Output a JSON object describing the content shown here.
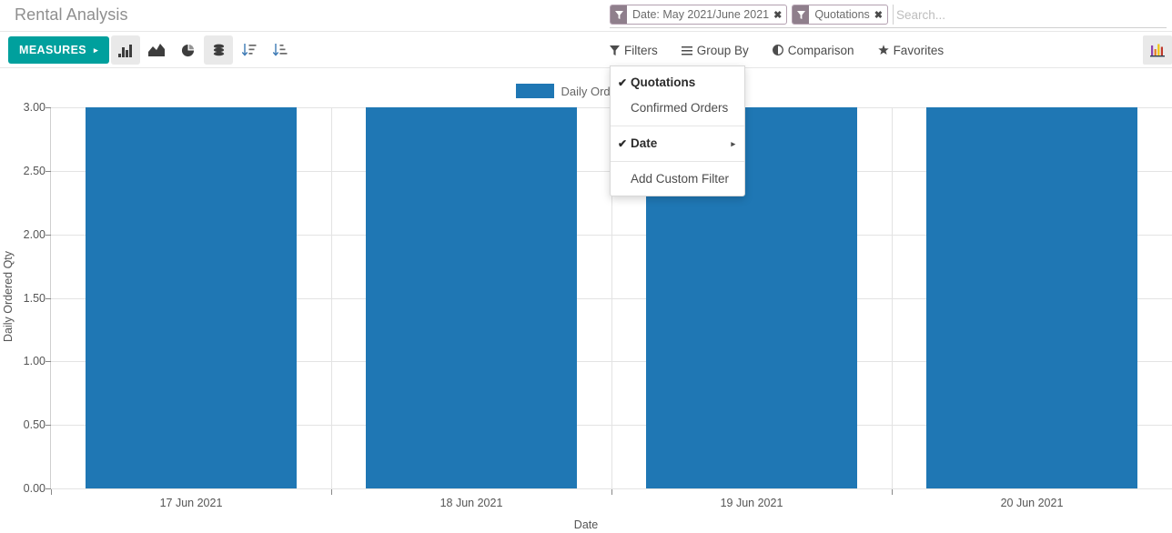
{
  "breadcrumb": "Rental Analysis",
  "search": {
    "placeholder": "Search...",
    "facets": [
      {
        "icon": "filter-icon",
        "label": "Date: May 2021/June 2021",
        "remove": "✖"
      },
      {
        "icon": "filter-icon",
        "label": "Quotations",
        "remove": "✖"
      }
    ],
    "value": ""
  },
  "toolbar": {
    "measures_label": "MEASURES",
    "measures_caret": "▸",
    "view_buttons": [
      {
        "name": "bar-chart-icon",
        "active": true
      },
      {
        "name": "line-chart-icon",
        "active": false
      },
      {
        "name": "pie-chart-icon",
        "active": false
      },
      {
        "name": "stacked-icon",
        "active": true
      },
      {
        "name": "sort-descending-icon",
        "active": false
      },
      {
        "name": "sort-ascending-icon",
        "active": false
      }
    ],
    "menus": [
      {
        "name": "filters-menu",
        "label": "Filters",
        "icon": "filter-icon"
      },
      {
        "name": "group-by-menu",
        "label": "Group By",
        "icon": "bars-icon"
      },
      {
        "name": "comparison-menu",
        "label": "Comparison",
        "icon": "adjust-icon"
      },
      {
        "name": "favorites-menu",
        "label": "Favorites",
        "icon": "star-icon"
      }
    ],
    "view_switcher": [
      {
        "name": "graph-view-icon",
        "active": true
      }
    ]
  },
  "filters_dropdown": {
    "open": true,
    "groups": [
      {
        "items": [
          {
            "label": "Quotations",
            "checked": true,
            "check": "✔"
          },
          {
            "label": "Confirmed Orders",
            "checked": false,
            "check": ""
          }
        ]
      },
      {
        "items": [
          {
            "label": "Date",
            "checked": true,
            "check": "✔",
            "caret": "▸"
          }
        ]
      },
      {
        "items": [
          {
            "label": "Add Custom Filter",
            "checked": false,
            "check": ""
          }
        ]
      }
    ]
  },
  "chart_data": {
    "type": "bar",
    "title": "",
    "legend": [
      {
        "label": "Daily Ordered Qty",
        "color": "#1f77b4"
      }
    ],
    "legend_position": "top-center",
    "categories": [
      "17 Jun 2021",
      "18 Jun 2021",
      "19 Jun 2021",
      "20 Jun 2021"
    ],
    "values": [
      3,
      3,
      3,
      3
    ],
    "xlabel": "Date",
    "ylabel": "Daily Ordered Qty",
    "ylim": [
      0,
      3
    ],
    "yticks": [
      "0.00",
      "0.50",
      "1.00",
      "1.50",
      "2.00",
      "2.50",
      "3.00"
    ],
    "ytick_values": [
      0,
      0.5,
      1,
      1.5,
      2,
      2.5,
      3
    ],
    "grid": true,
    "bar_color": "#1f77b4"
  }
}
